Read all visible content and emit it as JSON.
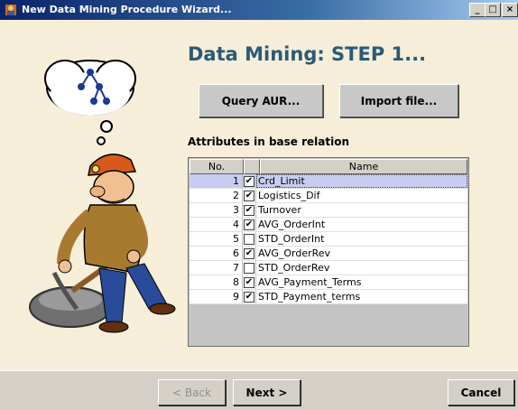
{
  "window": {
    "title": "New Data Mining Procedure Wizard...",
    "min_label": "_",
    "max_label": "□",
    "close_label": "×"
  },
  "main": {
    "heading": "Data Mining: STEP 1...",
    "query_button": "Query AUR...",
    "import_button": "Import file...",
    "attributes_label": "Attributes in base relation"
  },
  "table": {
    "headers": {
      "no": "No.",
      "check": "",
      "name": "Name"
    },
    "rows": [
      {
        "no": "1",
        "checked": true,
        "name": "Crd_Limit",
        "selected": true
      },
      {
        "no": "2",
        "checked": true,
        "name": "Logistics_Dif",
        "selected": false
      },
      {
        "no": "3",
        "checked": true,
        "name": "Turnover",
        "selected": false
      },
      {
        "no": "4",
        "checked": true,
        "name": "AVG_OrderInt",
        "selected": false
      },
      {
        "no": "5",
        "checked": false,
        "name": "STD_OrderInt",
        "selected": false
      },
      {
        "no": "6",
        "checked": true,
        "name": "AVG_OrderRev",
        "selected": false
      },
      {
        "no": "7",
        "checked": false,
        "name": "STD_OrderRev",
        "selected": false
      },
      {
        "no": "8",
        "checked": true,
        "name": "AVG_Payment_Terms",
        "selected": false
      },
      {
        "no": "9",
        "checked": true,
        "name": "STD_Payment_terms",
        "selected": false
      }
    ]
  },
  "footer": {
    "back_label": "< Back",
    "next_label": "Next >",
    "cancel_label": "Cancel"
  },
  "icons": {
    "app": "miner-app-icon",
    "thought": "tree-diagram-icon",
    "illustration": "miner-pickaxe-illustration"
  },
  "colors": {
    "background": "#f6eed8",
    "heading": "#2a5a78",
    "selected_row": "#c8ccf0"
  }
}
